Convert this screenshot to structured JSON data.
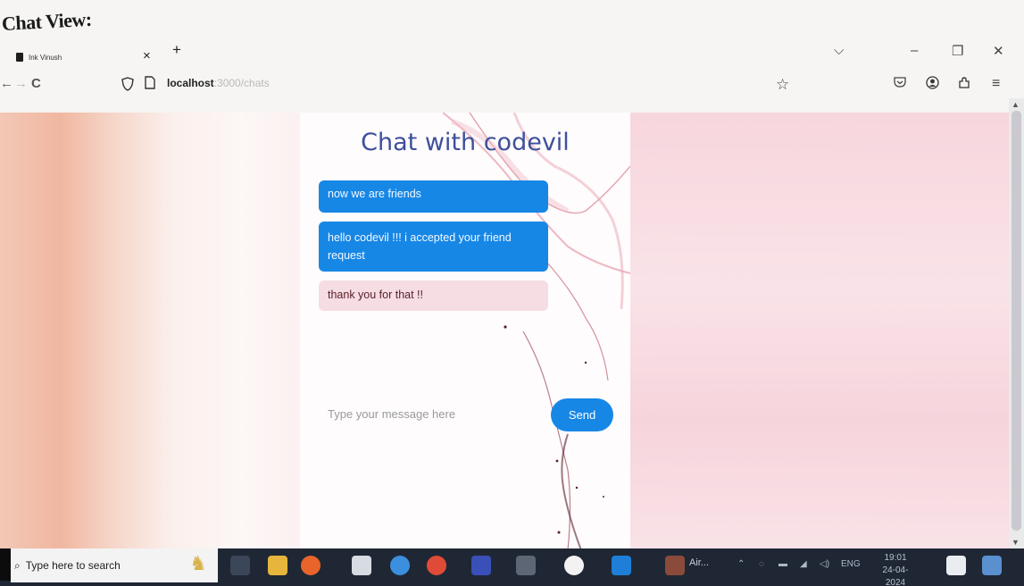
{
  "document": {
    "heading": "Chat View:"
  },
  "browser": {
    "tab": {
      "title": "Ink Vinush",
      "close": "×",
      "new_tab": "+"
    },
    "window_controls": {
      "list": "⌵",
      "minimize": "–",
      "restore": "❐",
      "close": "✕"
    },
    "nav": {
      "back": "←",
      "forward": "→",
      "reload": "C"
    },
    "url": {
      "host": "localhost",
      "path": ":3000/chats"
    },
    "toolbar_icons": [
      "bookmark-star-icon",
      "pocket-icon",
      "account-icon",
      "extensions-icon",
      "menu-icon"
    ]
  },
  "chat": {
    "title": "Chat with codevil",
    "messages": [
      {
        "text": "now we are friends",
        "type": "sent"
      },
      {
        "text": "hello codevil !!! i accepted your friend request",
        "type": "sent"
      },
      {
        "text": "thank you for that !!",
        "type": "received"
      }
    ],
    "input": {
      "placeholder": "Type your message here",
      "value": ""
    },
    "send_label": "Send"
  },
  "taskbar": {
    "search_placeholder": "Type here to search",
    "app_labels": [
      "Air..."
    ],
    "language": "ENG",
    "time": "19:01",
    "date": "24-04-2024"
  },
  "colors": {
    "sent_bubble": "#1787e6",
    "received_bubble": "#f5dde3",
    "title": "#3e4f9c",
    "send_button": "#1787e6"
  }
}
